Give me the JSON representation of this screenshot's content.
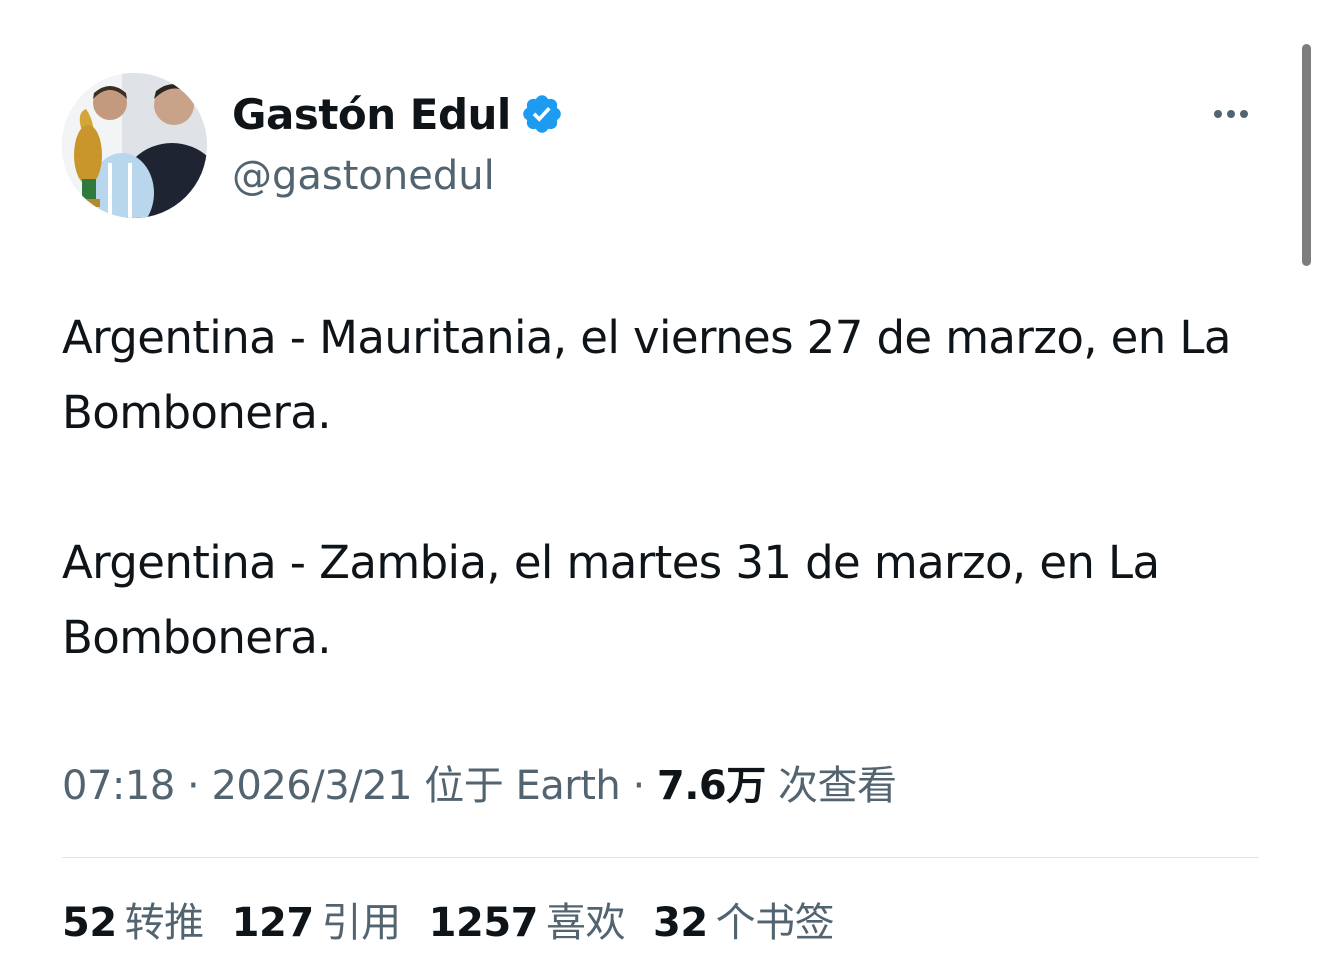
{
  "author": {
    "display_name": "Gastón Edul",
    "handle": "@gastonedul",
    "verified": true,
    "avatar_icon": "profile-photo"
  },
  "more_icon": "more-horizontal-icon",
  "tweet": {
    "paragraphs": [
      "Argentina - Mauritania, el viernes 27 de marzo, en La Bombonera.",
      "Argentina - Zambia, el martes 31 de marzo, en La Bombonera."
    ]
  },
  "meta": {
    "time": "07:18",
    "separator": " · ",
    "date": "2026/3/21",
    "location": "位于 Earth",
    "views_count": "7.6万",
    "views_label": "次查看"
  },
  "stats": [
    {
      "count": "52",
      "label": "转推"
    },
    {
      "count": "127",
      "label": "引用"
    },
    {
      "count": "1257",
      "label": "喜欢"
    },
    {
      "count": "32",
      "label": "个书签"
    }
  ],
  "colors": {
    "text_primary": "#0f1419",
    "text_secondary": "#536471",
    "verified_blue": "#1d9bf0",
    "divider": "#e1e5e8"
  }
}
